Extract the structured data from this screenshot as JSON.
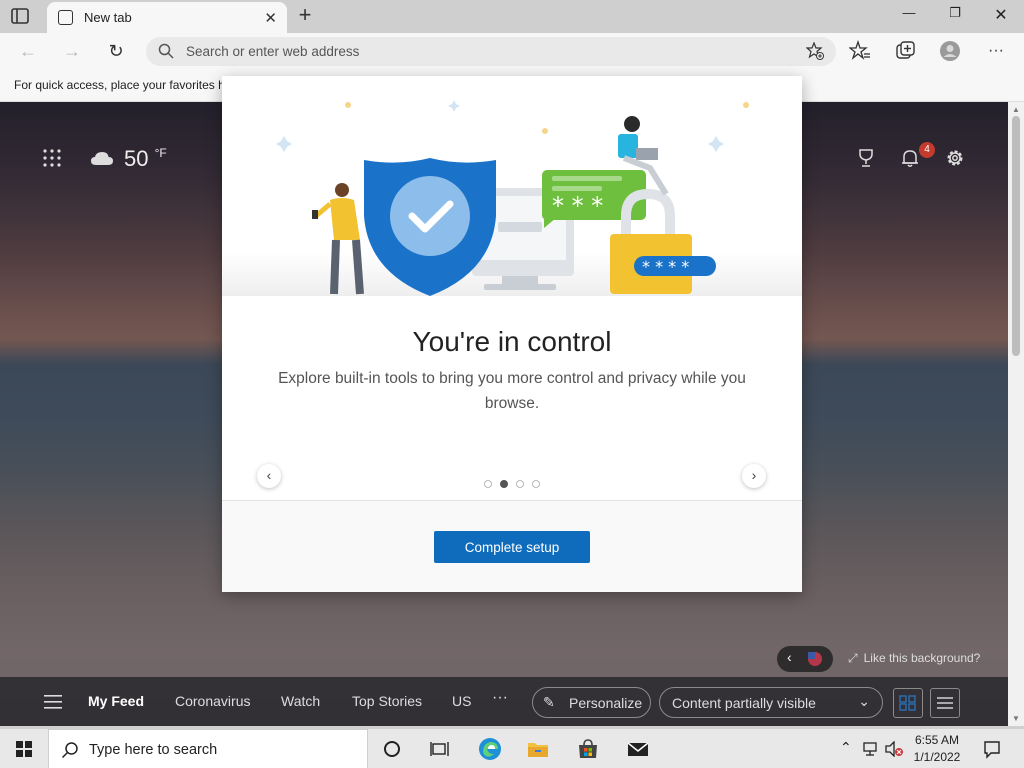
{
  "browser": {
    "tab_title": "New tab",
    "address_placeholder": "Search or enter web address",
    "favorites_bar_text": "For quick access, place your favorites h"
  },
  "newtab": {
    "temperature": "50",
    "temperature_unit": "°F",
    "notification_count": "4",
    "like_background": "Like this background?"
  },
  "feed": {
    "tabs": [
      "My Feed",
      "Coronavirus",
      "Watch",
      "Top Stories",
      "US"
    ],
    "more": "···",
    "personalize_label": "Personalize",
    "content_visibility": "Content partially visible"
  },
  "modal": {
    "title": "You're in control",
    "description": "Explore built-in tools to bring you more control and privacy while you browse.",
    "password_dots_1": "* * *",
    "password_dots_2": "* * * *",
    "button_label": "Complete setup",
    "slide_count": 4,
    "active_slide": 2
  },
  "taskbar": {
    "search_placeholder": "Type here to search",
    "time": "6:55 AM",
    "date": "1/1/2022"
  },
  "colors": {
    "accent": "#0f6cbd",
    "shield_blue": "#1a73c9",
    "badge_red": "#c43b2e",
    "bubble_green": "#6fbf3f",
    "lock_yellow": "#f2c230"
  },
  "icons": {
    "tab_actions": "tab-actions-icon",
    "back": "back-arrow-icon",
    "forward": "forward-arrow-icon",
    "refresh": "refresh-icon",
    "search": "search-icon",
    "add_favorite": "add-favorite-icon",
    "favorites": "favorites-icon",
    "collections": "collections-icon",
    "profile": "profile-icon",
    "more": "more-icon"
  }
}
